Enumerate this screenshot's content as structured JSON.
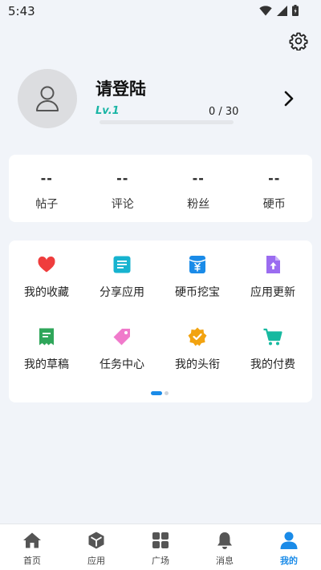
{
  "status": {
    "time": "5:43"
  },
  "profile": {
    "name": "请登陆",
    "level": "Lv.1",
    "progress_text": "0 / 30",
    "progress_fraction": 0
  },
  "stats": [
    {
      "value": "--",
      "label": "帖子"
    },
    {
      "value": "--",
      "label": "评论"
    },
    {
      "value": "--",
      "label": "粉丝"
    },
    {
      "value": "--",
      "label": "硬币"
    }
  ],
  "grid": [
    {
      "label": "我的收藏",
      "icon": "heart-icon",
      "color": "#ef3d3d"
    },
    {
      "label": "分享应用",
      "icon": "share-icon",
      "color": "#17b3cf"
    },
    {
      "label": "硬币挖宝",
      "icon": "coin-envelope-icon",
      "color": "#1a8be8"
    },
    {
      "label": "应用更新",
      "icon": "update-file-icon",
      "color": "#9b6cf0"
    },
    {
      "label": "我的草稿",
      "icon": "draft-icon",
      "color": "#2fa65a"
    },
    {
      "label": "任务中心",
      "icon": "tag-icon",
      "color": "#f07acb"
    },
    {
      "label": "我的头衔",
      "icon": "badge-icon",
      "color": "#f2a310"
    },
    {
      "label": "我的付费",
      "icon": "cart-icon",
      "color": "#17b9a0"
    }
  ],
  "nav": [
    {
      "label": "首页",
      "icon": "home-icon"
    },
    {
      "label": "应用",
      "icon": "apps-cube-icon"
    },
    {
      "label": "广场",
      "icon": "grid-icon"
    },
    {
      "label": "消息",
      "icon": "bell-icon"
    },
    {
      "label": "我的",
      "icon": "person-icon"
    }
  ],
  "colors": {
    "accent": "#1a8be8",
    "level": "#19b5a5",
    "background": "#f1f4f9"
  }
}
